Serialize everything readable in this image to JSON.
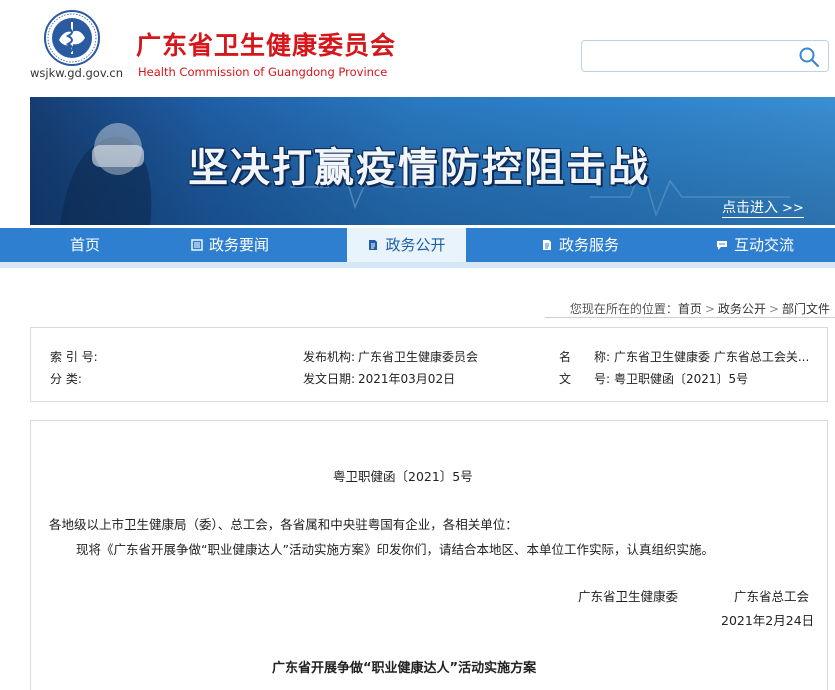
{
  "header": {
    "domain": "wsjkw.gd.gov.cn",
    "title_cn": "广东省卫生健康委员会",
    "title_en": "Health Commission of Guangdong Province",
    "search_placeholder": ""
  },
  "banner": {
    "slogan": "坚决打赢疫情防控阻击战",
    "link_label": "点击进入",
    "link_arrow": ">>"
  },
  "nav": {
    "items": [
      {
        "label": "首页",
        "icon": "none"
      },
      {
        "label": "政务要闻",
        "icon": "newspaper-icon"
      },
      {
        "label": "政务公开",
        "icon": "document-icon",
        "active": true
      },
      {
        "label": "政务服务",
        "icon": "service-doc-icon"
      },
      {
        "label": "互动交流",
        "icon": "chat-icon"
      }
    ]
  },
  "breadcrumb": {
    "prefix": "您现在所在的位置：",
    "items": [
      "首页",
      "政务公开",
      "部门文件"
    ],
    "separator": ">"
  },
  "meta": {
    "index_label": "索 引 号:",
    "index_value": "",
    "category_label": "分    类:",
    "category_value": "",
    "publisher_label": "发布机构:",
    "publisher_value": "广东省卫生健康委员会",
    "date_label": "发文日期:",
    "date_value": "2021年03月02日",
    "name_label_a": "名",
    "name_label_b": "称:",
    "name_value": "广东省卫生健康委 广东省总工会关...",
    "docno_label_a": "文",
    "docno_label_b": "号:",
    "docno_value": "粤卫职健函〔2021〕5号"
  },
  "document": {
    "doc_number": "粤卫职健函〔2021〕5号",
    "addressee": "各地级以上市卫生健康局（委）、总工会，各省属和中央驻粤国有企业，各相关单位：",
    "body": "现将《广东省开展争做“职业健康达人”活动实施方案》印发你们，请结合本地区、本单位工作实际，认真组织实施。",
    "signer_1": "广东省卫生健康委",
    "signer_2": "广东省总工会",
    "sign_date": "2021年2月24日",
    "title": "广东省开展争做“职业健康达人”活动实施方案"
  },
  "colors": {
    "brand_red": "#d5161a",
    "nav_blue": "#2f7fd0",
    "nav_active_bg": "#e9f3fc"
  }
}
